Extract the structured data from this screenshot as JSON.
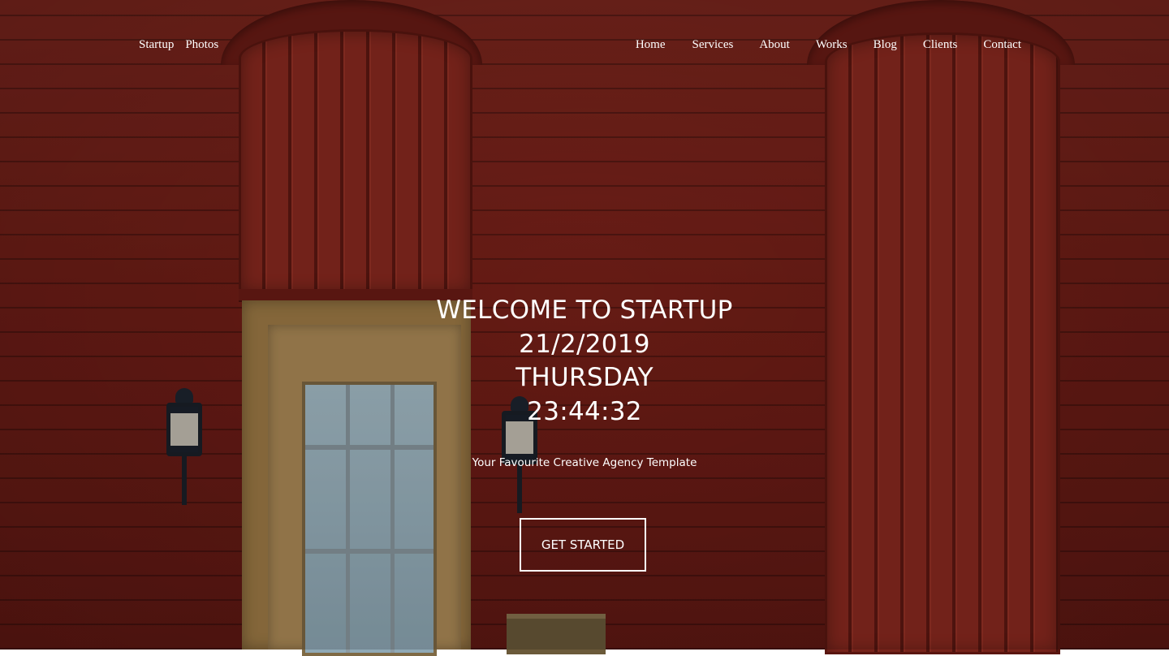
{
  "brand": {
    "name": "Startup",
    "sub": "Photos"
  },
  "nav": {
    "items": [
      "Home",
      "Services",
      "About",
      "Works",
      "Blog",
      "Clients",
      "Contact"
    ]
  },
  "hero": {
    "title": "WELCOME TO STARTUP",
    "date": "21/2/2019",
    "day": "THURSDAY",
    "time": "23:44:32",
    "tagline": "Your Favourite Creative Agency Template",
    "cta_label": "GET STARTED"
  },
  "colors": {
    "brick": "#7a1f19",
    "text": "#ffffff"
  }
}
